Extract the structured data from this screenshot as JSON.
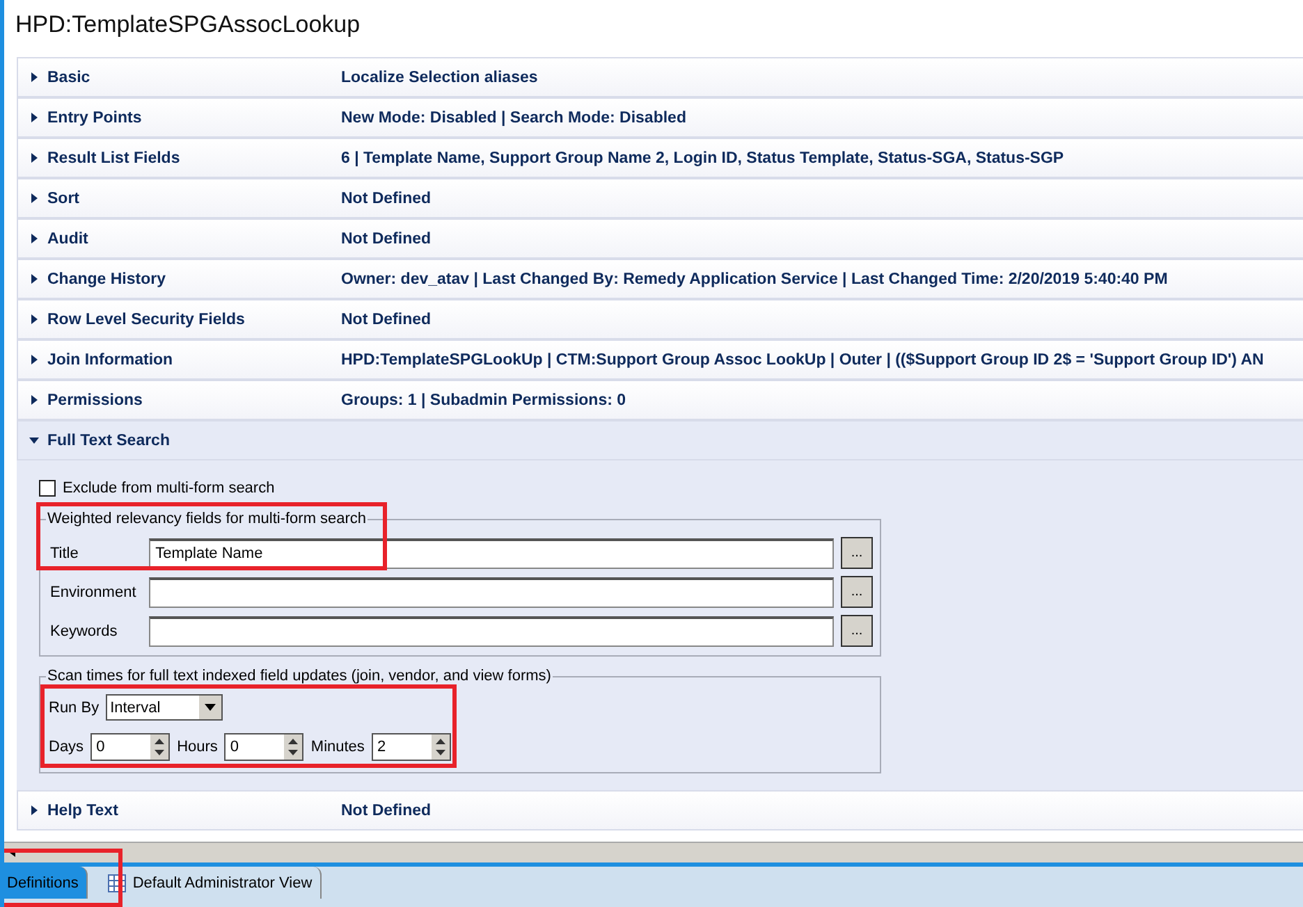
{
  "title": "HPD:TemplateSPGAssocLookup",
  "sections": [
    {
      "label": "Basic",
      "value": "Localize Selection aliases",
      "expanded": false
    },
    {
      "label": "Entry Points",
      "value": "New Mode: Disabled | Search Mode: Disabled",
      "expanded": false
    },
    {
      "label": "Result List Fields",
      "value": "6 | Template Name, Support Group Name 2, Login ID, Status Template, Status-SGA, Status-SGP",
      "expanded": false
    },
    {
      "label": "Sort",
      "value": "Not Defined",
      "expanded": false
    },
    {
      "label": "Audit",
      "value": "Not Defined",
      "expanded": false
    },
    {
      "label": "Change History",
      "value": "Owner: dev_atav | Last Changed By: Remedy Application Service | Last Changed Time: 2/20/2019 5:40:40 PM",
      "expanded": false
    },
    {
      "label": "Row Level Security Fields",
      "value": "Not Defined",
      "expanded": false
    },
    {
      "label": "Join Information",
      "value": "HPD:TemplateSPGLookUp | CTM:Support Group Assoc LookUp | Outer | (($Support Group ID 2$ = 'Support Group ID') AN",
      "expanded": false
    },
    {
      "label": "Permissions",
      "value": "Groups: 1 | Subadmin Permissions: 0",
      "expanded": false
    },
    {
      "label": "Full Text Search",
      "expanded": true
    },
    {
      "label": "Help Text",
      "value": "Not Defined",
      "expanded": false
    }
  ],
  "full_text_search": {
    "exclude": {
      "label": "Exclude from multi-form search",
      "checked": false
    },
    "weighted": {
      "legend": "Weighted relevancy fields for multi-form search",
      "fields": [
        {
          "label": "Title",
          "value": "Template Name",
          "button": "..."
        },
        {
          "label": "Environment",
          "button": "..."
        },
        {
          "label": "Keywords",
          "button": "..."
        }
      ]
    },
    "scan": {
      "legend": "Scan times for full text indexed field updates (join, vendor, and view forms)",
      "run_by_label": "Run By",
      "run_by": "Interval",
      "spinners": [
        {
          "label": "Days",
          "value": "0"
        },
        {
          "label": "Hours",
          "value": "0"
        },
        {
          "label": "Minutes",
          "value": "2"
        }
      ]
    }
  },
  "tabs": [
    {
      "label": "Definitions",
      "selected": true
    },
    {
      "label": "Default Administrator View",
      "selected": false
    }
  ]
}
